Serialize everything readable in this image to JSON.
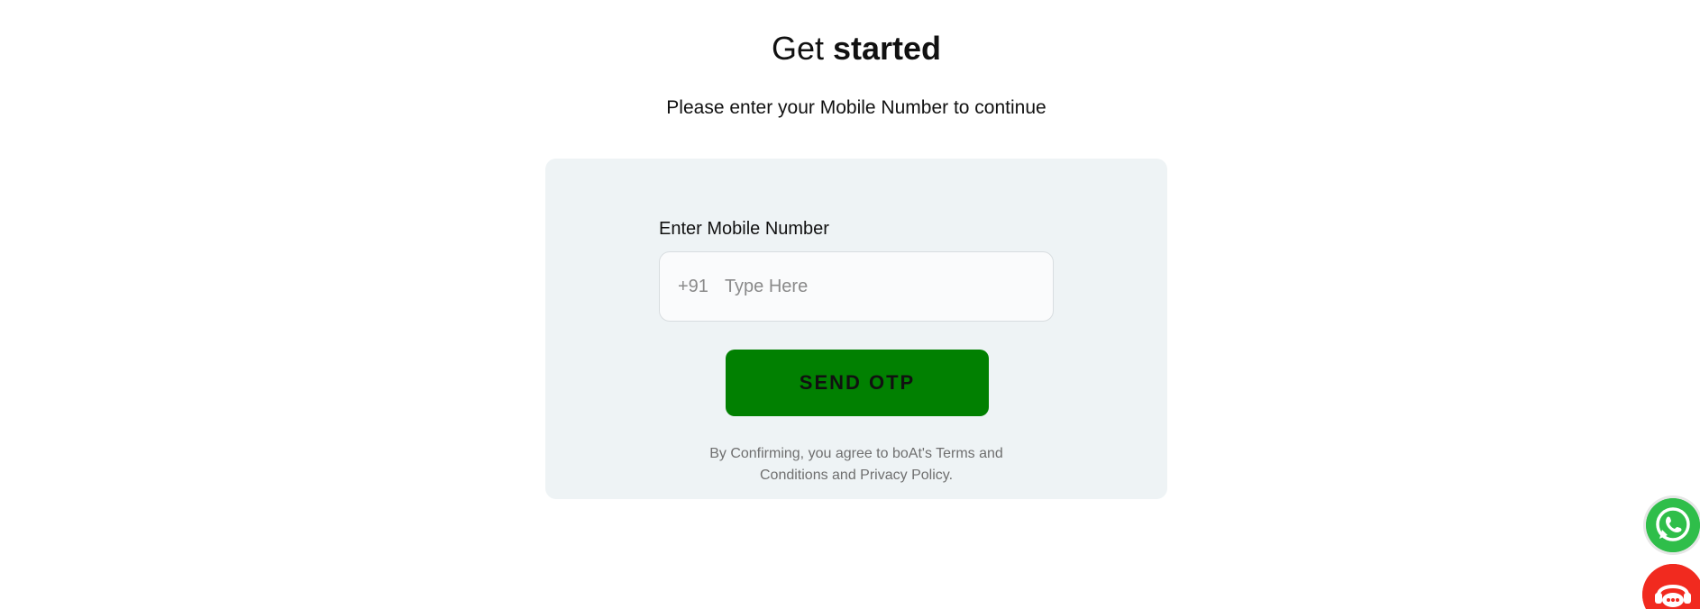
{
  "header": {
    "title_regular": "Get",
    "title_bold": "started",
    "subtitle": "Please enter your Mobile Number to continue"
  },
  "form": {
    "label": "Enter Mobile Number",
    "country_code": "+91",
    "placeholder": "Type Here",
    "value": "",
    "submit_label": "SEND OTP",
    "terms": "By Confirming, you agree to boAt's Terms and Conditions and Privacy Policy."
  },
  "floating": {
    "whatsapp_icon": "whatsapp-icon",
    "chat_icon": "chat-support-icon"
  },
  "colors": {
    "primary_button": "#018001",
    "card_background": "#eef3f5",
    "whatsapp": "#2fbe4a",
    "chat": "#f12a1f"
  }
}
